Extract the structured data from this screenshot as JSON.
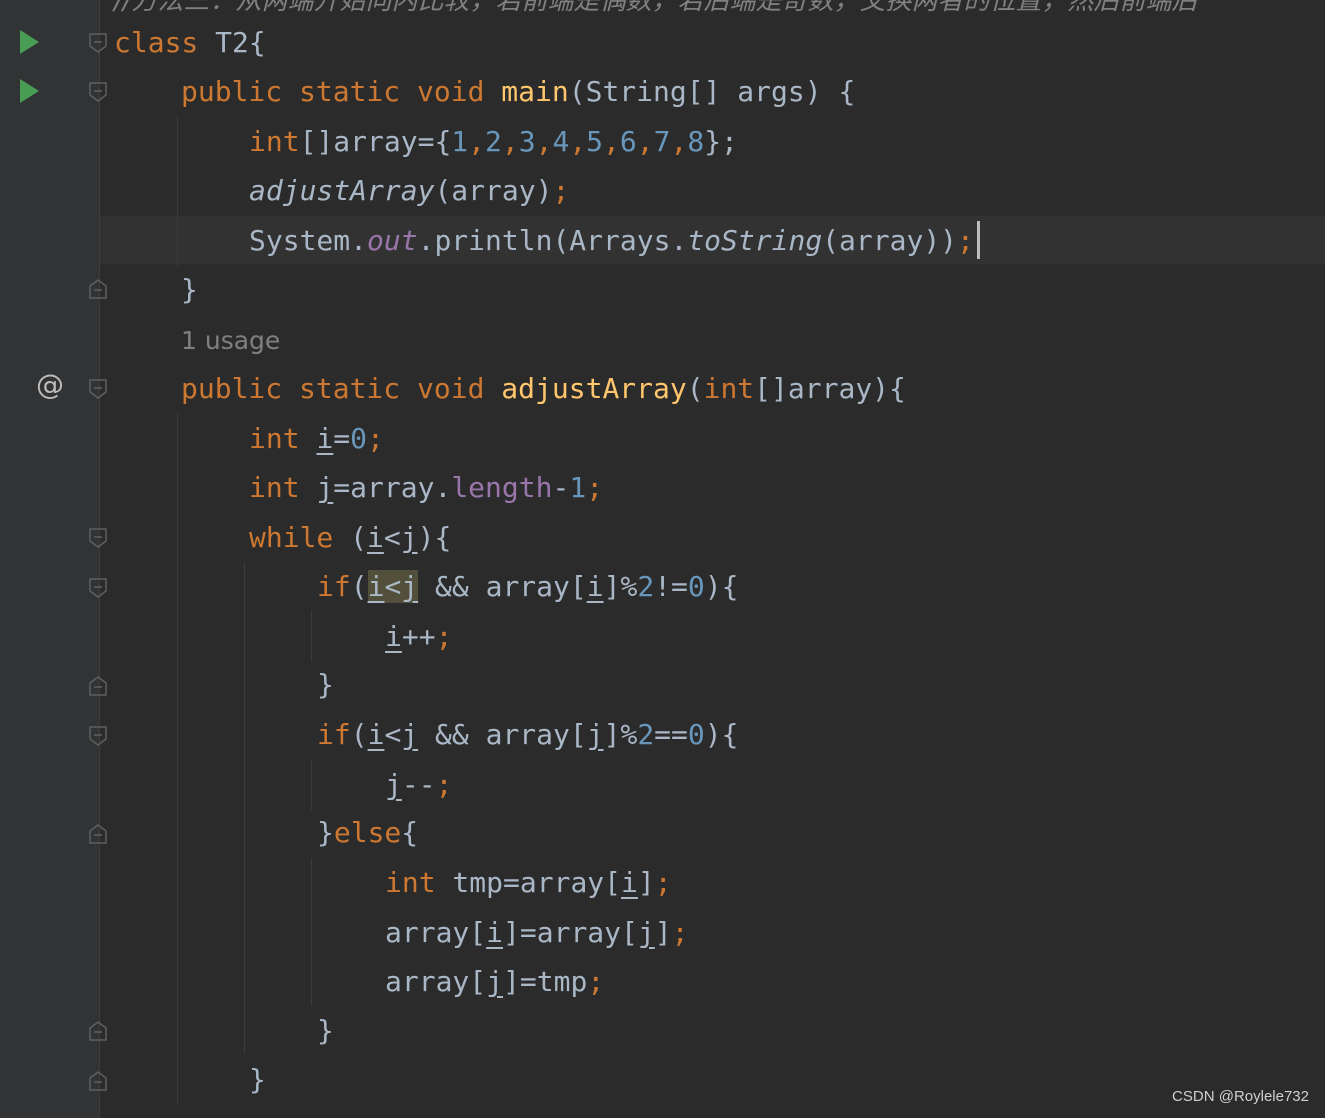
{
  "editor": {
    "top_comment": "//方法三：从两端开始向内比较，若前端是偶数，若后端是奇数，交换两者的位置，然后前端后",
    "usage_hint": "1 usage",
    "lines": {
      "class_decl": {
        "kw": "class",
        "name": "T2{"
      },
      "main_decl": {
        "mods": "public static void",
        "name": "main",
        "params": "(String[] args) {"
      },
      "array_init": {
        "type": "int",
        "rest": "[]array={",
        "n1": "1",
        "n2": "2",
        "n3": "3",
        "n4": "4",
        "n5": "5",
        "n6": "6",
        "n7": "7",
        "n8": "8",
        "close": "};"
      },
      "call_adjust": {
        "name": "adjustArray",
        "args": "(array)",
        "semi": ";"
      },
      "println": {
        "sys": "System.",
        "out": "out",
        "dot": ".println(Arrays.",
        "tostr": "toString",
        "args": "(array))",
        "semi": ";"
      },
      "close_main": "}",
      "adjust_decl": {
        "mods": "public static void",
        "name": "adjustArray",
        "lp": "(",
        "type": "int",
        "rest": "[]array){"
      },
      "int_i": {
        "type": "int",
        "var": "i",
        "eq": "=",
        "val": "0",
        "semi": ";"
      },
      "int_j": {
        "type": "int",
        "var": "j",
        "eq": "=array.",
        "field": "length",
        "minus": "-",
        "val": "1",
        "semi": ";"
      },
      "while": {
        "kw": "while",
        "open": " (",
        "i": "i",
        "lt": "<",
        "j": "j",
        "close": "){"
      },
      "if1": {
        "kw": "if",
        "lp": "(",
        "i": "i",
        "lt": "<",
        "j": "j",
        "mid": " && array[",
        "i2": "i",
        "mod": "]%",
        "two": "2",
        "ne": "!=",
        "zero": "0",
        "close": "){"
      },
      "i_inc": {
        "var": "i",
        "op": "++",
        "semi": ";"
      },
      "close_if1": "}",
      "if2": {
        "kw": "if",
        "lp": "(",
        "i": "i",
        "lt": "<",
        "j": "j",
        "mid": " && array[",
        "j2": "j",
        "mod": "]%",
        "two": "2",
        "eq": "==",
        "zero": "0",
        "close": "){"
      },
      "j_dec": {
        "var": "j",
        "op": "--",
        "semi": ";"
      },
      "else": {
        "br": "}",
        "kw": "else",
        "open": "{"
      },
      "tmp": {
        "type": "int",
        "rest": " tmp=array[",
        "i": "i",
        "close": "]",
        "semi": ";"
      },
      "swap1": {
        "a": "array[",
        "i": "i",
        "b": "]=array[",
        "j": "j",
        "c": "]",
        "semi": ";"
      },
      "swap2": {
        "a": "array[",
        "j": "j",
        "b": "]=tmp",
        "semi": ";"
      },
      "close_else": "}",
      "close_while": "}"
    }
  },
  "gutter": {
    "run_icon": "run-triangle-icon",
    "override_icon": "@"
  },
  "watermark": "CSDN @Roylele732",
  "colors": {
    "background": "#2b2b2b",
    "keyword": "#cc7832",
    "function": "#ffc66d",
    "number": "#6897bb",
    "field": "#9876aa",
    "text": "#a9b7c6"
  }
}
